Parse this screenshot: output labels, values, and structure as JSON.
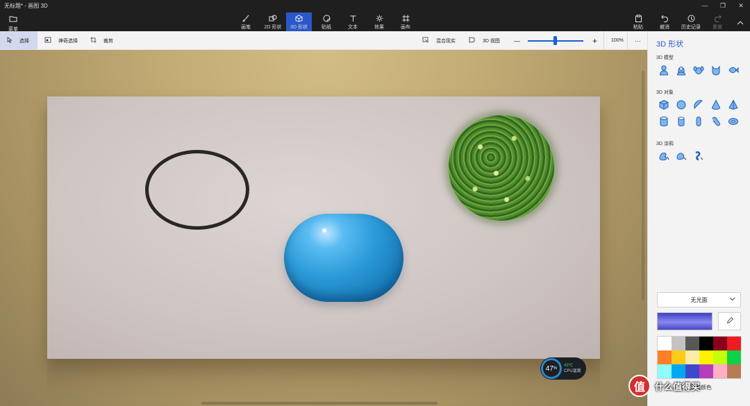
{
  "window": {
    "title": "无标题* - 画图 3D",
    "minimize": "—",
    "restore": "❐",
    "close": "✕"
  },
  "menu": {
    "label": "菜单"
  },
  "tools": [
    {
      "label": "画笔"
    },
    {
      "label": "2D 形状"
    },
    {
      "label": "3D 形状"
    },
    {
      "label": "贴纸"
    },
    {
      "label": "文本"
    },
    {
      "label": "效果"
    },
    {
      "label": "画布"
    }
  ],
  "actions": {
    "paste": "粘贴",
    "undo": "撤消",
    "history": "历史记录",
    "redo": "重做"
  },
  "subbar": {
    "select": "选择",
    "magic_select": "神奇选择",
    "crop": "裁剪",
    "mixed_reality": "混合现实",
    "view_3d": "3D 视图",
    "zoom_minus": "—",
    "zoom_plus": "+",
    "zoom_level": "100%",
    "more": "···"
  },
  "cpu": {
    "percent": "47",
    "percent_unit": "%",
    "temp": "43℃",
    "label": "CPU温度"
  },
  "panel": {
    "title": "3D 形状",
    "models_label": "3D 模型",
    "objects_label": "3D 对象",
    "doodle_label": "3D 涂鸦",
    "finish_selected": "无光面",
    "footer": "添加颜色",
    "palette": [
      "#ffffff",
      "#c3c3c3",
      "#585858",
      "#000000",
      "#88001b",
      "#ec1c24",
      "#ff7f27",
      "#ffca18",
      "#fdeca6",
      "#fff200",
      "#c4ff0e",
      "#0ed145",
      "#8cfffb",
      "#00a8f3",
      "#3f48cc",
      "#b83dba",
      "#ffaec8",
      "#b97a56"
    ]
  },
  "watermark": {
    "glyph": "值",
    "text": "什么值得买"
  }
}
